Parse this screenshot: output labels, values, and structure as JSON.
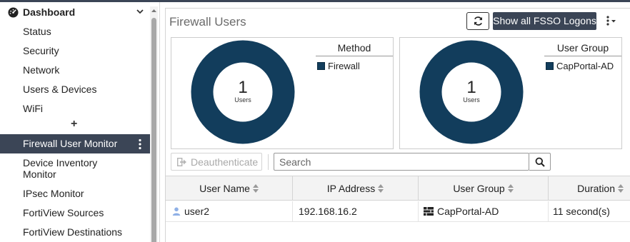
{
  "sidebar": {
    "header": "Dashboard",
    "items": [
      "Status",
      "Security",
      "Network",
      "Users & Devices",
      "WiFi"
    ],
    "add_label": "+",
    "active_item": "Firewall User Monitor",
    "items_after": [
      "Device Inventory Monitor",
      "IPsec Monitor",
      "FortiView Sources",
      "FortiView Destinations"
    ]
  },
  "panel": {
    "title": "Firewall Users",
    "fsso_button": "Show all FSSO Logons",
    "refresh_icon": "refresh-icon",
    "more_icon": "more-vertical-icon"
  },
  "cards": [
    {
      "legend_title": "Method",
      "legend_item": "Firewall",
      "count": "1",
      "unit": "Users",
      "color": "#123d5c"
    },
    {
      "legend_title": "User Group",
      "legend_item": "CapPortal-AD",
      "count": "1",
      "unit": "Users",
      "color": "#123d5c"
    }
  ],
  "toolbar": {
    "deauth_label": "Deauthenticate",
    "search_placeholder": "Search"
  },
  "table": {
    "columns": [
      "User Name",
      "IP Address",
      "User Group",
      "Duration"
    ],
    "rows": [
      {
        "user": "user2",
        "ip": "192.168.16.2",
        "group": "CapPortal-AD",
        "duration": "11 second(s)"
      }
    ]
  },
  "colors": {
    "accent": "#3b4556",
    "donut": "#123d5c",
    "user_icon": "#8fb0e6"
  }
}
